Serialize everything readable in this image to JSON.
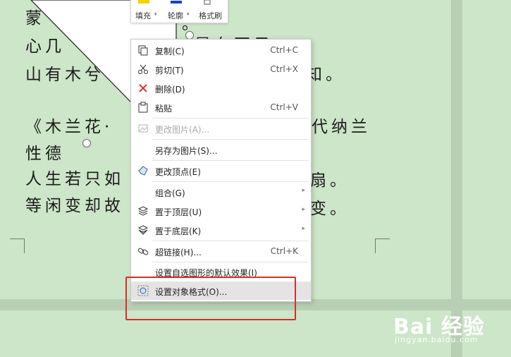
{
  "document": {
    "line1": "蒙",
    "line2": "心几",
    "line3": "山有木兮",
    "line3_tail": "知。",
    "line4": "《木兰花·",
    "line4_tail": "代纳兰",
    "line5": "性德",
    "line6": "人生若只如",
    "line6_tail": "扇。",
    "line7": "等闲变却故",
    "line7_tail": "变。",
    "frag_top": "。",
    "frag_line2": "是在不孑"
  },
  "mini_toolbar": {
    "fill_label": "填充",
    "outline_label": "轮廓",
    "format_painter_label": "格式刷",
    "fill_color": "#f5d20a",
    "outline_color": "#1a3fd1"
  },
  "context_menu": {
    "items": [
      {
        "label": "复制(C)",
        "shortcut": "Ctrl+C",
        "icon": "copy-icon"
      },
      {
        "label": "剪切(T)",
        "shortcut": "Ctrl+X",
        "icon": "cut-icon"
      },
      {
        "label": "删除(D)",
        "shortcut": "",
        "icon": "delete-icon"
      },
      {
        "label": "粘贴",
        "shortcut": "Ctrl+V",
        "icon": "paste-icon"
      },
      {
        "label": "更改图片(A)...",
        "shortcut": "",
        "icon": "change-image-icon",
        "disabled": true
      },
      {
        "label": "另存为图片(S)...",
        "shortcut": "",
        "icon": ""
      },
      {
        "label": "更改顶点(E)",
        "shortcut": "",
        "icon": "edit-points-icon"
      },
      {
        "label": "组合(G)",
        "shortcut": "",
        "icon": "",
        "submenu": true
      },
      {
        "label": "置于顶层(U)",
        "shortcut": "",
        "icon": "bring-to-front-icon",
        "submenu": true
      },
      {
        "label": "置于底层(K)",
        "shortcut": "",
        "icon": "send-to-back-icon",
        "submenu": true
      },
      {
        "label": "超链接(H)...",
        "shortcut": "Ctrl+K",
        "icon": "hyperlink-icon"
      },
      {
        "label": "设置自选图形的默认效果(I)",
        "shortcut": "",
        "icon": ""
      },
      {
        "label": "设置对象格式(O)...",
        "shortcut": "",
        "icon": "format-object-icon",
        "highlighted": true
      }
    ],
    "submenu_arrow": "▸"
  },
  "watermark": {
    "logo": "Bai 经验",
    "url": "jingyan.baidu.com"
  },
  "colors": {
    "page_background": "#cde5c9",
    "highlight_box": "#e02a2a",
    "menu_highlight": "#e4e4e4"
  }
}
